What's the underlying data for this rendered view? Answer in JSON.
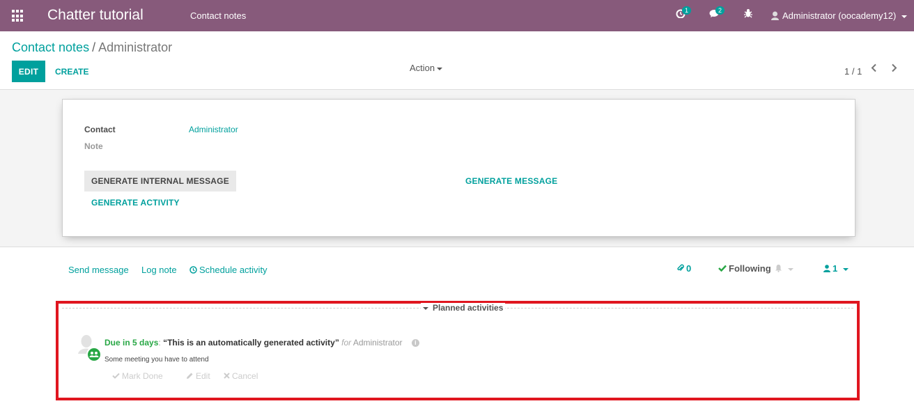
{
  "navbar": {
    "app_title": "Chatter tutorial",
    "menu_item": "Contact notes",
    "activity_count": "1",
    "messages_count": "2",
    "user": "Administrator (oocademy12)"
  },
  "control_panel": {
    "breadcrumb_parent": "Contact notes",
    "breadcrumb_separator": "/",
    "breadcrumb_current": "Administrator",
    "edit_label": "EDIT",
    "create_label": "CREATE",
    "action_label": "Action",
    "pager": "1 / 1"
  },
  "form": {
    "contact_label": "Contact",
    "contact_value": "Administrator",
    "note_label": "Note",
    "btn_generate_internal_message": "GENERATE INTERNAL MESSAGE",
    "btn_generate_message": "GENERATE MESSAGE",
    "btn_generate_activity": "GENERATE ACTIVITY"
  },
  "chatter": {
    "send_message": "Send message",
    "log_note": "Log note",
    "schedule_activity": "Schedule activity",
    "attachments_count": "0",
    "following": "Following",
    "followers_count": "1",
    "planned_title": "Planned activities",
    "activity": {
      "due": "Due in 5 days",
      "colon": ":",
      "summary": "“This is an automatically generated activity”",
      "for_label": "for",
      "user": "Administrator",
      "note": "Some meeting you have to attend",
      "mark_done": "Mark Done",
      "edit": "Edit",
      "cancel": "Cancel"
    }
  },
  "colors": {
    "brand": "#875a7b",
    "accent": "#00a09d",
    "due_green": "#28a745",
    "highlight_red": "#e0161f"
  }
}
